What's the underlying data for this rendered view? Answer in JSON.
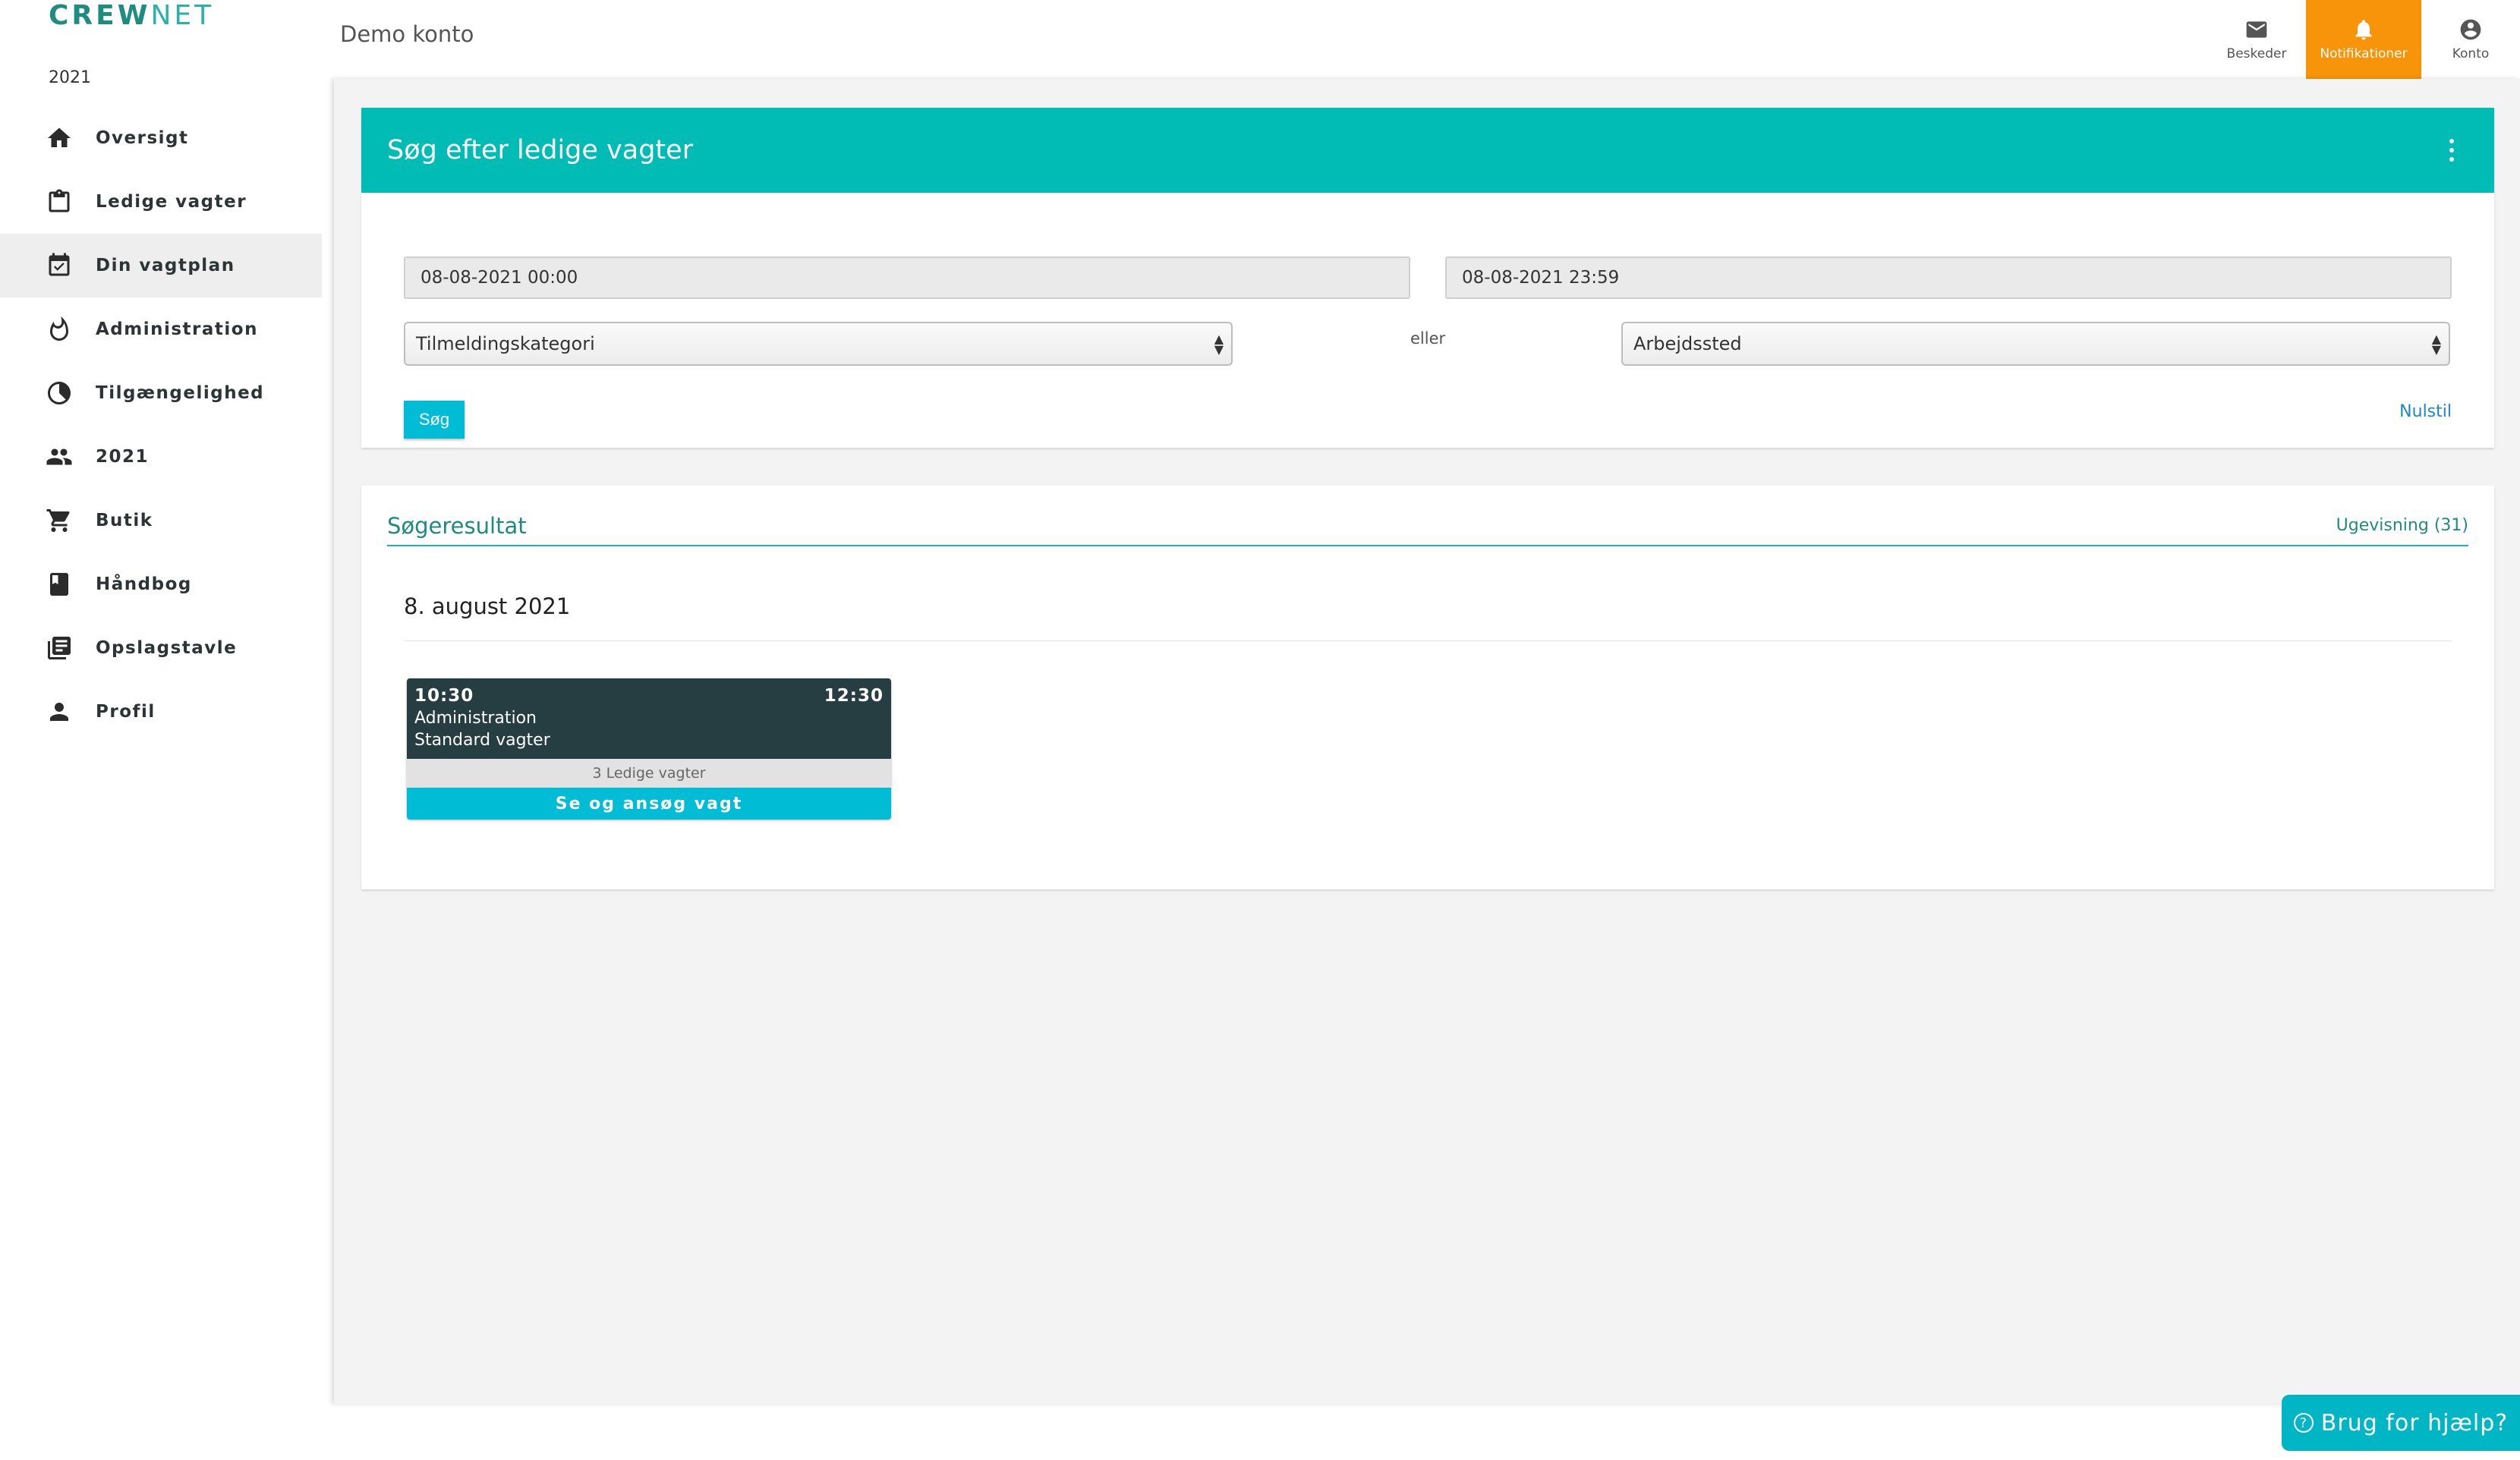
{
  "brand": {
    "part1": "CREW",
    "part2": "NET"
  },
  "sidebar": {
    "year": "2021",
    "items": [
      {
        "label": "Oversigt",
        "icon": "home-icon"
      },
      {
        "label": "Ledige vagter",
        "icon": "clipboard-icon"
      },
      {
        "label": "Din vagtplan",
        "icon": "calendar-check-icon",
        "active": true
      },
      {
        "label": "Administration",
        "icon": "flame-icon"
      },
      {
        "label": "Tilgængelighed",
        "icon": "half-circle-icon"
      },
      {
        "label": "2021",
        "icon": "people-icon"
      },
      {
        "label": "Butik",
        "icon": "cart-icon"
      },
      {
        "label": "Håndbog",
        "icon": "book-icon"
      },
      {
        "label": "Opslagstavle",
        "icon": "library-icon"
      },
      {
        "label": "Profil",
        "icon": "person-icon"
      }
    ]
  },
  "header": {
    "account": "Demo konto",
    "actions": {
      "messages": "Beskeder",
      "notifications": "Notifikationer",
      "account": "Konto"
    },
    "accent": "#f7940a"
  },
  "search": {
    "title": "Søg efter ledige vagter",
    "from": "08-08-2021 00:00",
    "to": "08-08-2021 23:59",
    "category": "Tilmeldingskategori",
    "or": "eller",
    "workplace": "Arbejdssted",
    "submit": "Søg",
    "reset": "Nulstil",
    "header_color": "#00bcb5"
  },
  "results": {
    "title": "Søgeresultat",
    "week_view": "Ugevisning (31)",
    "day": "8. august 2021",
    "shift": {
      "start": "10:30",
      "end": "12:30",
      "department": "Administration",
      "type": "Standard vagter",
      "available": "3 Ledige vagter",
      "apply": "Se og ansøg vagt"
    }
  },
  "help": {
    "label": "Brug for hjælp?"
  }
}
